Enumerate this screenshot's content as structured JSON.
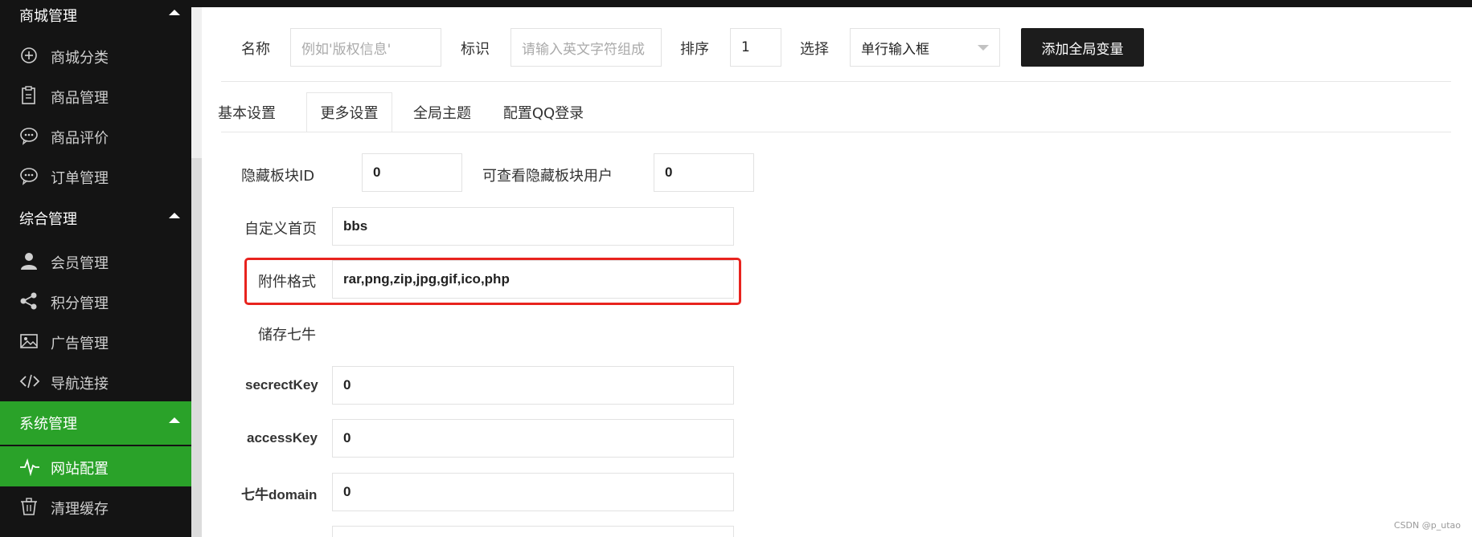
{
  "sidebar": {
    "groups": [
      {
        "title": "商城管理"
      },
      {
        "title": "综合管理"
      },
      {
        "title": "系统管理"
      }
    ],
    "items": [
      {
        "label": "商城分类",
        "icon": "plus-circle-icon"
      },
      {
        "label": "商品管理",
        "icon": "clipboard-icon"
      },
      {
        "label": "商品评价",
        "icon": "chat-icon"
      },
      {
        "label": "订单管理",
        "icon": "chat-icon"
      },
      {
        "label": "会员管理",
        "icon": "user-icon"
      },
      {
        "label": "积分管理",
        "icon": "share-icon"
      },
      {
        "label": "广告管理",
        "icon": "image-icon"
      },
      {
        "label": "导航连接",
        "icon": "code-icon"
      },
      {
        "label": "网站配置",
        "icon": "pulse-icon"
      },
      {
        "label": "清理缓存",
        "icon": "trash-icon"
      }
    ],
    "active_group_color": "#2aa229"
  },
  "var_form": {
    "name_label": "名称",
    "name_placeholder": "例如'版权信息'",
    "ident_label": "标识",
    "ident_placeholder": "请输入英文字符组成",
    "sort_label": "排序",
    "sort_value": "1",
    "type_label": "选择",
    "type_value": "单行输入框",
    "add_button": "添加全局变量"
  },
  "tabs": [
    {
      "label": "基本设置"
    },
    {
      "label": "更多设置"
    },
    {
      "label": "全局主题"
    },
    {
      "label": "配置QQ登录"
    }
  ],
  "active_tab": "更多设置",
  "settings": {
    "hidden_block_label": "隐藏板块ID",
    "hidden_block_value": "0",
    "hidden_users_label": "可查看隐藏板块用户",
    "hidden_users_value": "0",
    "homepage_label": "自定义首页",
    "homepage_value": "bbs",
    "attach_label": "附件格式",
    "attach_value": "rar,png,zip,jpg,gif,ico,php",
    "qiniu_label": "储存七牛",
    "secret_label": "secrectKey",
    "secret_value": "0",
    "access_label": "accessKey",
    "access_value": "0",
    "domain_label": "七牛domain",
    "domain_value": "0"
  },
  "highlight_color": "#e8231e",
  "watermark": "CSDN @p_utao"
}
